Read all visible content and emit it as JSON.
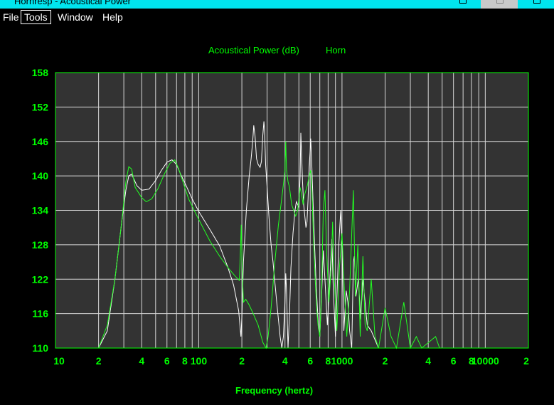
{
  "window": {
    "title": "Hornresp - Acoustical Power",
    "colors": {
      "titlebar": "#00e5ee",
      "background": "#000000"
    }
  },
  "menu": {
    "items": [
      {
        "label": "File",
        "active": false
      },
      {
        "label": "Tools",
        "active": true
      },
      {
        "label": "Window",
        "active": false
      },
      {
        "label": "Help",
        "active": false
      }
    ]
  },
  "chart_data": {
    "type": "line",
    "title": "Acoustical Power (dB)",
    "subtitle": "Horn",
    "xlabel": "Frequency (hertz)",
    "ylabel": "",
    "x_scale": "log",
    "xlim": [
      10,
      20000
    ],
    "ylim": [
      110,
      158
    ],
    "grid": true,
    "colors": {
      "plot_bg": "#333333",
      "grid": "#d8d8d8",
      "frame": "#00ff00",
      "text": "#00ff00"
    },
    "y_ticks": [
      "110",
      "116",
      "122",
      "128",
      "134",
      "140",
      "146",
      "152",
      "158"
    ],
    "x_ticks": [
      {
        "value": 10,
        "label": "10"
      },
      {
        "value": 20,
        "label": "2"
      },
      {
        "value": 40,
        "label": "4"
      },
      {
        "value": 60,
        "label": "6"
      },
      {
        "value": 80,
        "label": "8"
      },
      {
        "value": 100,
        "label": "100"
      },
      {
        "value": 200,
        "label": "2"
      },
      {
        "value": 400,
        "label": "4"
      },
      {
        "value": 600,
        "label": "6"
      },
      {
        "value": 800,
        "label": "8"
      },
      {
        "value": 1000,
        "label": "1000"
      },
      {
        "value": 2000,
        "label": "2"
      },
      {
        "value": 4000,
        "label": "4"
      },
      {
        "value": 6000,
        "label": "6"
      },
      {
        "value": 8000,
        "label": "8"
      },
      {
        "value": 10000,
        "label": "10000"
      },
      {
        "value": 20000,
        "label": "2"
      }
    ],
    "grid_x": [
      20,
      30,
      40,
      50,
      60,
      70,
      80,
      90,
      100,
      200,
      300,
      400,
      500,
      600,
      700,
      800,
      900,
      1000,
      2000,
      3000,
      4000,
      5000,
      6000,
      7000,
      8000,
      9000,
      10000
    ],
    "series": [
      {
        "color": "#ffffff",
        "points": [
          [
            20,
            110
          ],
          [
            23,
            113
          ],
          [
            26,
            122
          ],
          [
            29,
            132
          ],
          [
            31,
            137.5
          ],
          [
            32.5,
            140
          ],
          [
            34,
            140.3
          ],
          [
            37,
            138.3
          ],
          [
            40,
            137.5
          ],
          [
            45,
            137.7
          ],
          [
            50,
            139.2
          ],
          [
            55,
            141
          ],
          [
            60,
            142.4
          ],
          [
            65,
            142.8
          ],
          [
            70,
            142
          ],
          [
            75,
            140.2
          ],
          [
            80,
            138.8
          ],
          [
            90,
            136
          ],
          [
            100,
            133.8
          ],
          [
            120,
            130.6
          ],
          [
            140,
            127.8
          ],
          [
            160,
            124
          ],
          [
            175,
            121
          ],
          [
            190,
            116.5
          ],
          [
            197,
            112
          ],
          [
            200,
            115.5
          ],
          [
            205,
            125
          ],
          [
            215,
            134
          ],
          [
            225,
            140
          ],
          [
            232,
            143
          ],
          [
            238,
            146
          ],
          [
            242,
            148.8
          ],
          [
            247,
            147
          ],
          [
            253,
            143
          ],
          [
            260,
            142
          ],
          [
            268,
            141.5
          ],
          [
            274,
            142.5
          ],
          [
            280,
            147
          ],
          [
            285,
            149.5
          ],
          [
            288,
            148
          ],
          [
            293,
            142
          ],
          [
            300,
            138
          ],
          [
            310,
            132.5
          ],
          [
            320,
            128
          ],
          [
            330,
            125
          ],
          [
            340,
            121.5
          ],
          [
            350,
            118
          ],
          [
            360,
            115
          ],
          [
            370,
            112
          ],
          [
            380,
            110
          ],
          [
            390,
            112
          ],
          [
            400,
            118
          ],
          [
            405,
            123
          ],
          [
            410,
            120
          ],
          [
            420,
            110
          ],
          [
            430,
            116
          ],
          [
            440,
            124
          ],
          [
            455,
            130
          ],
          [
            470,
            134
          ],
          [
            480,
            135.5
          ],
          [
            490,
            135
          ],
          [
            500,
            134.5
          ],
          [
            510,
            140
          ],
          [
            516,
            147.5
          ],
          [
            522,
            144
          ],
          [
            530,
            139
          ],
          [
            540,
            135
          ],
          [
            550,
            133
          ],
          [
            560,
            131
          ],
          [
            570,
            132
          ],
          [
            580,
            136
          ],
          [
            590,
            141.5
          ],
          [
            600,
            144.5
          ],
          [
            605,
            146.5
          ],
          [
            615,
            142
          ],
          [
            625,
            137
          ],
          [
            635,
            132
          ],
          [
            645,
            127.5
          ],
          [
            660,
            121
          ],
          [
            680,
            115
          ],
          [
            700,
            112
          ],
          [
            720,
            119
          ],
          [
            740,
            127
          ],
          [
            760,
            122
          ],
          [
            790,
            114
          ],
          [
            830,
            124
          ],
          [
            850,
            129
          ],
          [
            870,
            120
          ],
          [
            900,
            112
          ],
          [
            950,
            128
          ],
          [
            980,
            134
          ],
          [
            1000,
            128
          ],
          [
            1030,
            113
          ],
          [
            1070,
            120
          ],
          [
            1100,
            118
          ],
          [
            1130,
            113
          ],
          [
            1170,
            110
          ],
          [
            1200,
            125
          ],
          [
            1220,
            126
          ],
          [
            1250,
            119
          ],
          [
            1300,
            122
          ],
          [
            1350,
            115
          ],
          [
            1400,
            122
          ],
          [
            1500,
            114
          ],
          [
            1600,
            113
          ],
          [
            1800,
            110
          ]
        ]
      },
      {
        "color": "#22ff22",
        "points": [
          [
            20,
            110
          ],
          [
            23,
            114
          ],
          [
            26,
            122
          ],
          [
            29,
            132
          ],
          [
            31,
            139
          ],
          [
            32.5,
            141.6
          ],
          [
            34,
            141.2
          ],
          [
            36,
            138
          ],
          [
            40,
            136.2
          ],
          [
            43,
            135.5
          ],
          [
            47,
            136
          ],
          [
            52,
            137.8
          ],
          [
            58,
            140.5
          ],
          [
            63,
            142.2
          ],
          [
            68,
            142.8
          ],
          [
            72,
            141.4
          ],
          [
            78,
            138.8
          ],
          [
            85,
            136
          ],
          [
            95,
            133.5
          ],
          [
            105,
            131.4
          ],
          [
            120,
            128.6
          ],
          [
            140,
            126
          ],
          [
            160,
            124
          ],
          [
            180,
            122.5
          ],
          [
            192,
            121.8
          ],
          [
            195,
            126
          ],
          [
            198,
            131.5
          ],
          [
            201,
            124
          ],
          [
            205,
            118
          ],
          [
            213,
            118.5
          ],
          [
            225,
            117.5
          ],
          [
            240,
            116
          ],
          [
            260,
            114
          ],
          [
            280,
            111
          ],
          [
            295,
            110
          ],
          [
            305,
            112
          ],
          [
            320,
            117
          ],
          [
            340,
            125
          ],
          [
            360,
            131.5
          ],
          [
            375,
            135
          ],
          [
            390,
            138.5
          ],
          [
            400,
            141
          ],
          [
            405,
            146
          ],
          [
            410,
            141
          ],
          [
            420,
            139
          ],
          [
            430,
            138
          ],
          [
            445,
            135
          ],
          [
            460,
            134
          ],
          [
            475,
            133
          ],
          [
            490,
            134
          ],
          [
            510,
            138
          ],
          [
            525,
            136.5
          ],
          [
            535,
            135
          ],
          [
            545,
            136.5
          ],
          [
            560,
            137.5
          ],
          [
            575,
            138.5
          ],
          [
            590,
            140
          ],
          [
            605,
            141
          ],
          [
            615,
            138
          ],
          [
            625,
            133
          ],
          [
            635,
            128
          ],
          [
            650,
            122
          ],
          [
            665,
            117
          ],
          [
            680,
            114
          ],
          [
            700,
            112
          ],
          [
            720,
            120
          ],
          [
            740,
            134
          ],
          [
            760,
            137.5
          ],
          [
            780,
            127
          ],
          [
            810,
            118
          ],
          [
            840,
            124
          ],
          [
            860,
            132
          ],
          [
            880,
            123
          ],
          [
            920,
            113
          ],
          [
            960,
            124
          ],
          [
            1000,
            130
          ],
          [
            1040,
            120
          ],
          [
            1080,
            112
          ],
          [
            1130,
            120
          ],
          [
            1170,
            130
          ],
          [
            1200,
            137.5
          ],
          [
            1240,
            119
          ],
          [
            1290,
            128
          ],
          [
            1340,
            112
          ],
          [
            1400,
            126
          ],
          [
            1450,
            114
          ],
          [
            1500,
            113
          ],
          [
            1600,
            122
          ],
          [
            1700,
            112
          ],
          [
            1800,
            110
          ],
          [
            2000,
            117
          ],
          [
            2200,
            112
          ],
          [
            2400,
            110
          ],
          [
            2700,
            118
          ],
          [
            3000,
            110
          ],
          [
            3300,
            112
          ],
          [
            3600,
            110
          ],
          [
            4500,
            112
          ],
          [
            4800,
            110
          ]
        ]
      }
    ]
  }
}
